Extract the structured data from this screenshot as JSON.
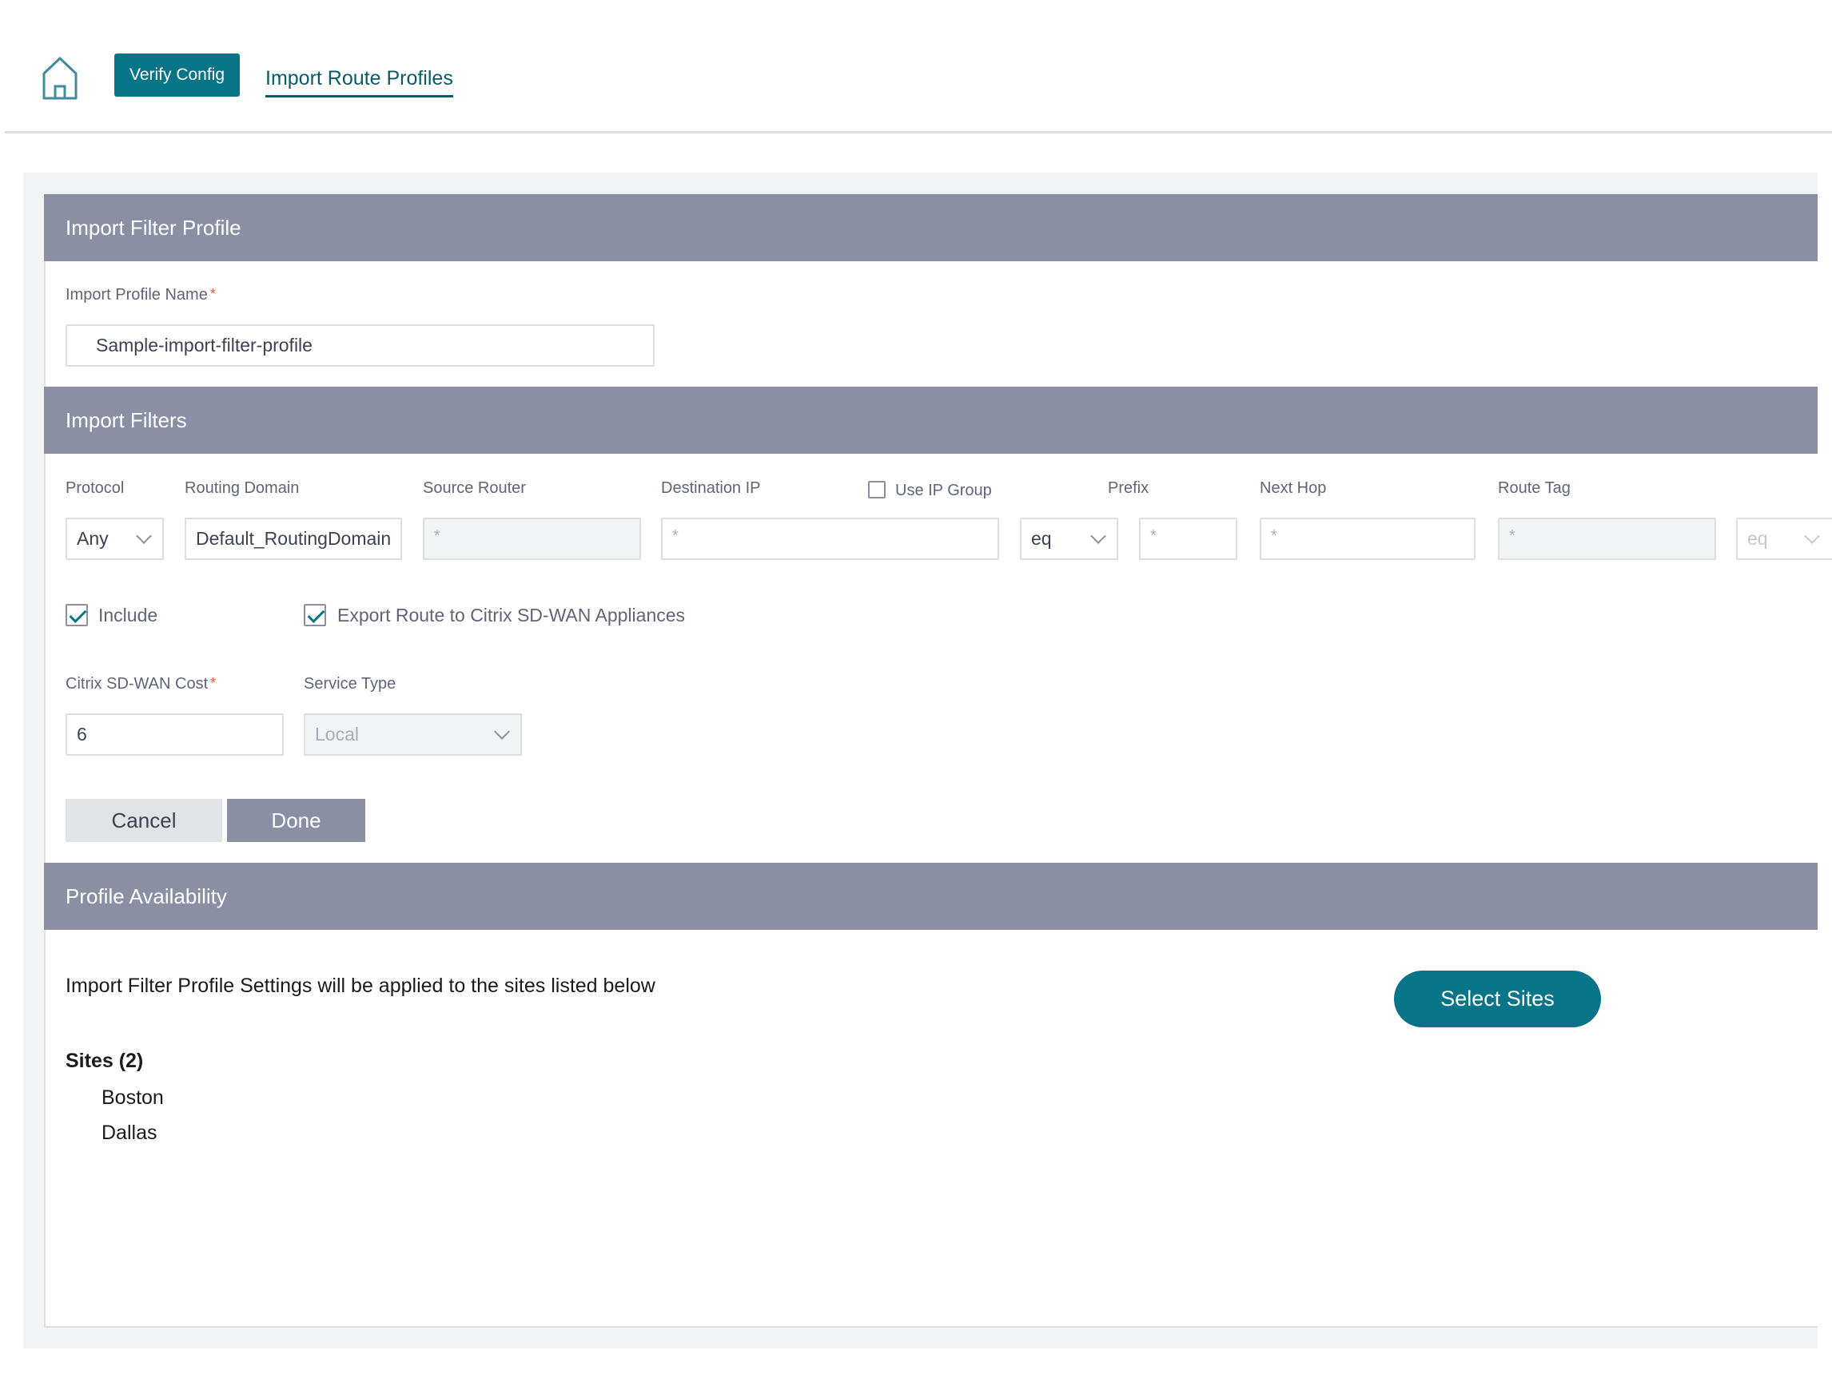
{
  "nav": {
    "verify_label": "Verify Config",
    "tab_label": "Import Route Profiles"
  },
  "profile": {
    "header": "Import Filter Profile",
    "name_label": "Import Profile Name",
    "required_mark": "*",
    "name_value": "Sample-import-filter-profile"
  },
  "filters": {
    "header": "Import Filters",
    "labels": {
      "protocol": "Protocol",
      "routing_domain": "Routing Domain",
      "source_router": "Source Router",
      "destination_ip": "Destination IP",
      "use_ip_group": "Use IP Group",
      "prefix": "Prefix",
      "next_hop": "Next Hop",
      "route_tag": "Route Tag"
    },
    "values": {
      "protocol": "Any",
      "routing_domain": "Default_RoutingDomain",
      "source_router": "*",
      "destination_ip": "*",
      "prefix_op": "eq",
      "prefix": "*",
      "next_hop": "*",
      "route_tag": "*",
      "route_tag_op": "eq"
    },
    "use_ip_group_checked": false,
    "include_label": "Include",
    "include_checked": true,
    "export_label": "Export Route to Citrix SD-WAN Appliances",
    "export_checked": true,
    "cost_label": "Citrix SD-WAN Cost",
    "cost_value": "6",
    "service_type_label": "Service Type",
    "service_type_value": "Local",
    "cancel_label": "Cancel",
    "done_label": "Done"
  },
  "availability": {
    "header": "Profile Availability",
    "description": "Import Filter Profile Settings will be applied to the sites listed below",
    "select_sites_label": "Select Sites",
    "sites_title": "Sites (2)",
    "sites": [
      "Boston",
      "Dallas"
    ]
  },
  "colors": {
    "accent": "#087487",
    "section_header": "#8a8fa3"
  }
}
